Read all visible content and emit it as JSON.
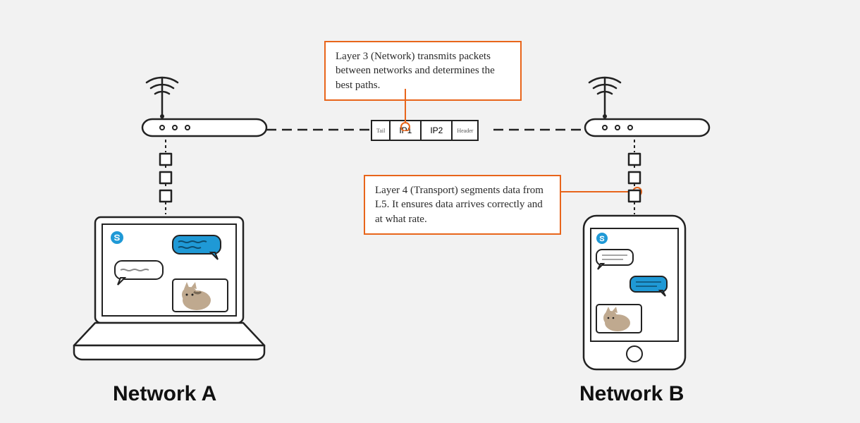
{
  "networks": {
    "a": {
      "label": "Network A"
    },
    "b": {
      "label": "Network B"
    }
  },
  "callouts": {
    "layer3": "Layer 3 (Network) transmits packets between networks and determines the best paths.",
    "layer4": "Layer 4 (Transport) segments data from L5. It ensures data arrives correctly and at what rate."
  },
  "packet": {
    "tail": "Tail",
    "ip1": "IP1",
    "ip2": "IP2",
    "header": "Header"
  },
  "icons": {
    "app": "skype-icon"
  }
}
